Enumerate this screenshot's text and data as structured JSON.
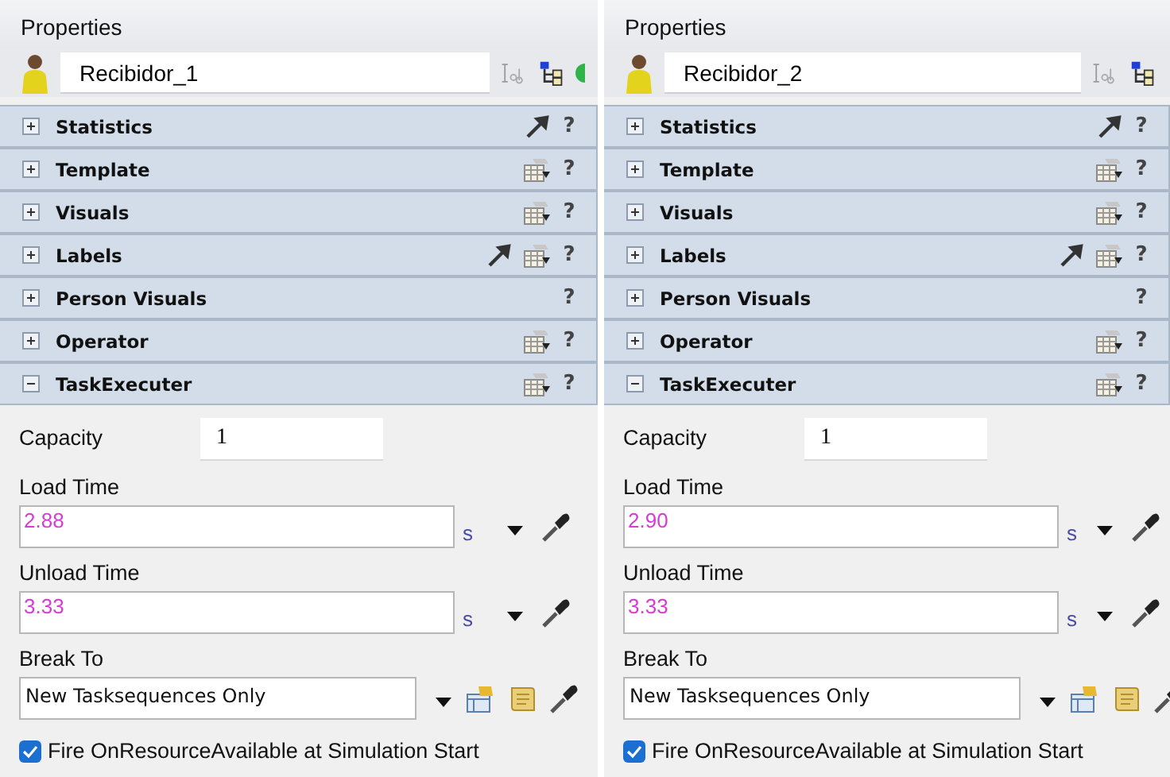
{
  "panels": [
    {
      "title": "Properties",
      "name": "Recibidor_1",
      "sections": [
        {
          "label": "Statistics",
          "expanded": false,
          "pointer_tool": true,
          "template_tool": false,
          "help": "?"
        },
        {
          "label": "Template",
          "expanded": false,
          "pointer_tool": false,
          "template_tool": true,
          "help": "?"
        },
        {
          "label": "Visuals",
          "expanded": false,
          "pointer_tool": false,
          "template_tool": true,
          "help": "?"
        },
        {
          "label": "Labels",
          "expanded": false,
          "pointer_tool": true,
          "template_tool": true,
          "help": "?"
        },
        {
          "label": "Person Visuals",
          "expanded": false,
          "pointer_tool": false,
          "template_tool": false,
          "help": "?"
        },
        {
          "label": "Operator",
          "expanded": false,
          "pointer_tool": false,
          "template_tool": true,
          "help": "?"
        },
        {
          "label": "TaskExecuter",
          "expanded": true,
          "pointer_tool": false,
          "template_tool": true,
          "help": "?"
        }
      ],
      "fields": [
        {
          "kind": "inline",
          "label": "Capacity",
          "value": "1"
        },
        {
          "kind": "timed",
          "label": "Load Time",
          "value": "2.88",
          "unit": "s"
        },
        {
          "kind": "timed",
          "label": "Unload Time",
          "value": "3.33",
          "unit": "s"
        },
        {
          "kind": "choice",
          "label": "Break To",
          "value": "New Tasksequences Only"
        }
      ],
      "checkbox": {
        "label": "Fire OnResourceAvailable at Simulation Start",
        "checked": true
      }
    },
    {
      "title": "Properties",
      "name": "Recibidor_2",
      "sections": [
        {
          "label": "Statistics",
          "expanded": false,
          "pointer_tool": true,
          "template_tool": false,
          "help": "?"
        },
        {
          "label": "Template",
          "expanded": false,
          "pointer_tool": false,
          "template_tool": true,
          "help": "?"
        },
        {
          "label": "Visuals",
          "expanded": false,
          "pointer_tool": false,
          "template_tool": true,
          "help": "?"
        },
        {
          "label": "Labels",
          "expanded": false,
          "pointer_tool": true,
          "template_tool": true,
          "help": "?"
        },
        {
          "label": "Person Visuals",
          "expanded": false,
          "pointer_tool": false,
          "template_tool": false,
          "help": "?"
        },
        {
          "label": "Operator",
          "expanded": false,
          "pointer_tool": false,
          "template_tool": true,
          "help": "?"
        },
        {
          "label": "TaskExecuter",
          "expanded": true,
          "pointer_tool": false,
          "template_tool": true,
          "help": "?"
        }
      ],
      "fields": [
        {
          "kind": "inline",
          "label": "Capacity",
          "value": "1"
        },
        {
          "kind": "timed",
          "label": "Load Time",
          "value": "2.90",
          "unit": "s"
        },
        {
          "kind": "timed",
          "label": "Unload Time",
          "value": "3.33",
          "unit": "s"
        },
        {
          "kind": "choice",
          "label": "Break To",
          "value": "New Tasksequences Only"
        }
      ],
      "checkbox": {
        "label": "Fire OnResourceAvailable at Simulation Start",
        "checked": true
      }
    }
  ]
}
